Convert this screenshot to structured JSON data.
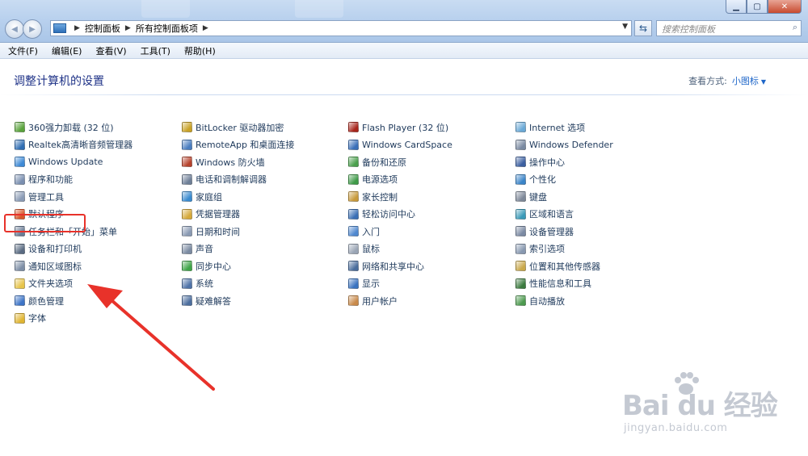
{
  "address": {
    "crumbs": [
      "控制面板",
      "所有控制面板项"
    ]
  },
  "search": {
    "placeholder": "搜索控制面板"
  },
  "window_controls": {
    "minimize": "▁",
    "maximize": "▢",
    "close": "✕"
  },
  "menubar": [
    "文件(F)",
    "编辑(E)",
    "查看(V)",
    "工具(T)",
    "帮助(H)"
  ],
  "header": {
    "title": "调整计算机的设置",
    "view_by_label": "查看方式:",
    "view_by_value": "小图标"
  },
  "columns": [
    [
      {
        "label": "360强力卸载 (32 位)",
        "icon": "uninstall-icon",
        "color": "#5aa33c"
      },
      {
        "label": "Realtek高清晰音频管理器",
        "icon": "speaker-icon",
        "color": "#2f6db3"
      },
      {
        "label": "Windows Update",
        "icon": "windows-update-icon",
        "color": "#3e8ad6"
      },
      {
        "label": "程序和功能",
        "icon": "programs-icon",
        "color": "#7a8fb0"
      },
      {
        "label": "管理工具",
        "icon": "admin-tools-icon",
        "color": "#8a9bb5"
      },
      {
        "label": "默认程序",
        "icon": "default-programs-icon",
        "color": "#d8562a"
      },
      {
        "label": "任务栏和「开始」菜单",
        "icon": "taskbar-icon",
        "color": "#6b7c95"
      },
      {
        "label": "设备和打印机",
        "icon": "printer-icon",
        "color": "#5a6b82"
      },
      {
        "label": "通知区域图标",
        "icon": "notification-icon",
        "color": "#7d8ea6"
      },
      {
        "label": "文件夹选项",
        "icon": "folder-options-icon",
        "color": "#e7c44a"
      },
      {
        "label": "颜色管理",
        "icon": "color-management-icon",
        "color": "#3d74c7"
      },
      {
        "label": "字体",
        "icon": "fonts-icon",
        "color": "#e0b532"
      }
    ],
    [
      {
        "label": "BitLocker 驱动器加密",
        "icon": "bitlocker-icon",
        "color": "#c9a227"
      },
      {
        "label": "RemoteApp 和桌面连接",
        "icon": "remoteapp-icon",
        "color": "#4a7ec0"
      },
      {
        "label": "Windows 防火墙",
        "icon": "firewall-icon",
        "color": "#b6422c"
      },
      {
        "label": "电话和调制解调器",
        "icon": "phone-modem-icon",
        "color": "#6e7f97"
      },
      {
        "label": "家庭组",
        "icon": "homegroup-icon",
        "color": "#3a8bd0"
      },
      {
        "label": "凭据管理器",
        "icon": "credential-icon",
        "color": "#d6a93a"
      },
      {
        "label": "日期和时间",
        "icon": "clock-icon",
        "color": "#8a9ab3"
      },
      {
        "label": "声音",
        "icon": "sound-icon",
        "color": "#7b8ba2"
      },
      {
        "label": "同步中心",
        "icon": "sync-icon",
        "color": "#3fa548"
      },
      {
        "label": "系统",
        "icon": "system-icon",
        "color": "#4f73a8"
      },
      {
        "label": "疑难解答",
        "icon": "troubleshoot-icon",
        "color": "#4c6e9e"
      }
    ],
    [
      {
        "label": "Flash Player (32 位)",
        "icon": "flash-icon",
        "color": "#a8261c"
      },
      {
        "label": "Windows CardSpace",
        "icon": "cardspace-icon",
        "color": "#3a6fb8"
      },
      {
        "label": "备份和还原",
        "icon": "backup-icon",
        "color": "#4aa04c"
      },
      {
        "label": "电源选项",
        "icon": "power-icon",
        "color": "#3f9b48"
      },
      {
        "label": "家长控制",
        "icon": "parental-icon",
        "color": "#c89a3b"
      },
      {
        "label": "轻松访问中心",
        "icon": "ease-access-icon",
        "color": "#3b6fb5"
      },
      {
        "label": "入门",
        "icon": "getting-started-icon",
        "color": "#4f88cf"
      },
      {
        "label": "鼠标",
        "icon": "mouse-icon",
        "color": "#9aa5b5"
      },
      {
        "label": "网络和共享中心",
        "icon": "network-icon",
        "color": "#4a6d9c"
      },
      {
        "label": "显示",
        "icon": "display-icon",
        "color": "#3a73c0"
      },
      {
        "label": "用户帐户",
        "icon": "user-accounts-icon",
        "color": "#c98a4a"
      }
    ],
    [
      {
        "label": "Internet 选项",
        "icon": "internet-icon",
        "color": "#6aa9d6"
      },
      {
        "label": "Windows Defender",
        "icon": "defender-icon",
        "color": "#7a8aa1"
      },
      {
        "label": "操作中心",
        "icon": "action-center-icon",
        "color": "#3b5fa0"
      },
      {
        "label": "个性化",
        "icon": "personalize-icon",
        "color": "#3a84c8"
      },
      {
        "label": "键盘",
        "icon": "keyboard-icon",
        "color": "#7d8898"
      },
      {
        "label": "区域和语言",
        "icon": "region-icon",
        "color": "#3a9ab8"
      },
      {
        "label": "设备管理器",
        "icon": "device-manager-icon",
        "color": "#7b8aa3"
      },
      {
        "label": "索引选项",
        "icon": "indexing-icon",
        "color": "#8898b0"
      },
      {
        "label": "位置和其他传感器",
        "icon": "location-icon",
        "color": "#c9a84a"
      },
      {
        "label": "性能信息和工具",
        "icon": "performance-icon",
        "color": "#3b7a3e"
      },
      {
        "label": "自动播放",
        "icon": "autoplay-icon",
        "color": "#4c9a4e"
      }
    ]
  ],
  "watermark": {
    "brand": "Bai du 经验",
    "url": "jingyan.baidu.com"
  },
  "colors": {
    "highlight": "#e8322a",
    "link": "#1e395b",
    "title": "#1e3287"
  }
}
